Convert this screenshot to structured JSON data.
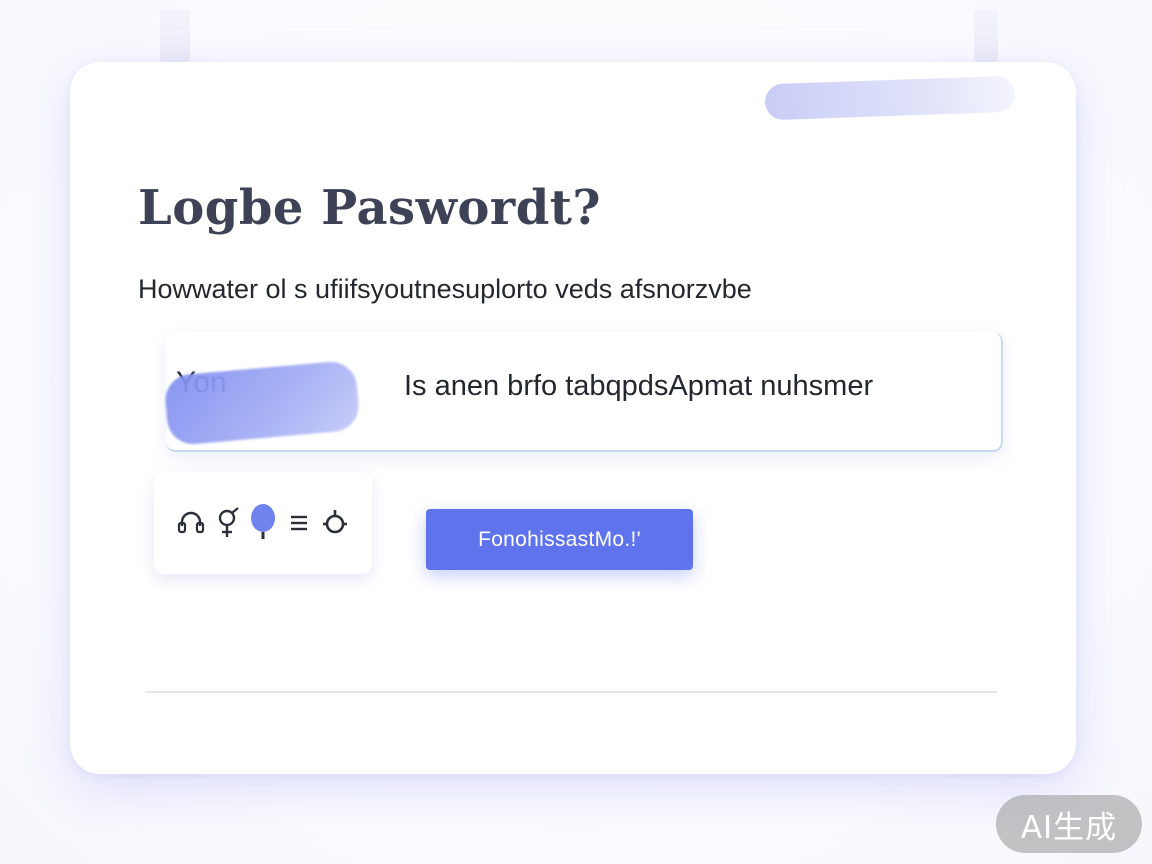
{
  "dialog": {
    "title": "Logbe Paswordt?",
    "subtitle": "Howwater ol s ufiifsyoutnesuplorto veds afsnorzvbe",
    "field": {
      "prefix": "Yon",
      "value": "Is anen brfo tabqpdsApmat nuhsmer"
    },
    "toolbar": {
      "icons": [
        "headset-icon",
        "gender-icon",
        "location-pin-icon",
        "menu-icon",
        "settings-icon"
      ]
    },
    "primary_button": {
      "label": "FonohissastMo.!'"
    }
  },
  "watermark": {
    "text": "AI生成"
  },
  "colors": {
    "accent": "#5e73ec",
    "highlight": "#8b98f1",
    "title": "#3d4256",
    "text": "#23272f",
    "divider": "#e4e6ee"
  }
}
